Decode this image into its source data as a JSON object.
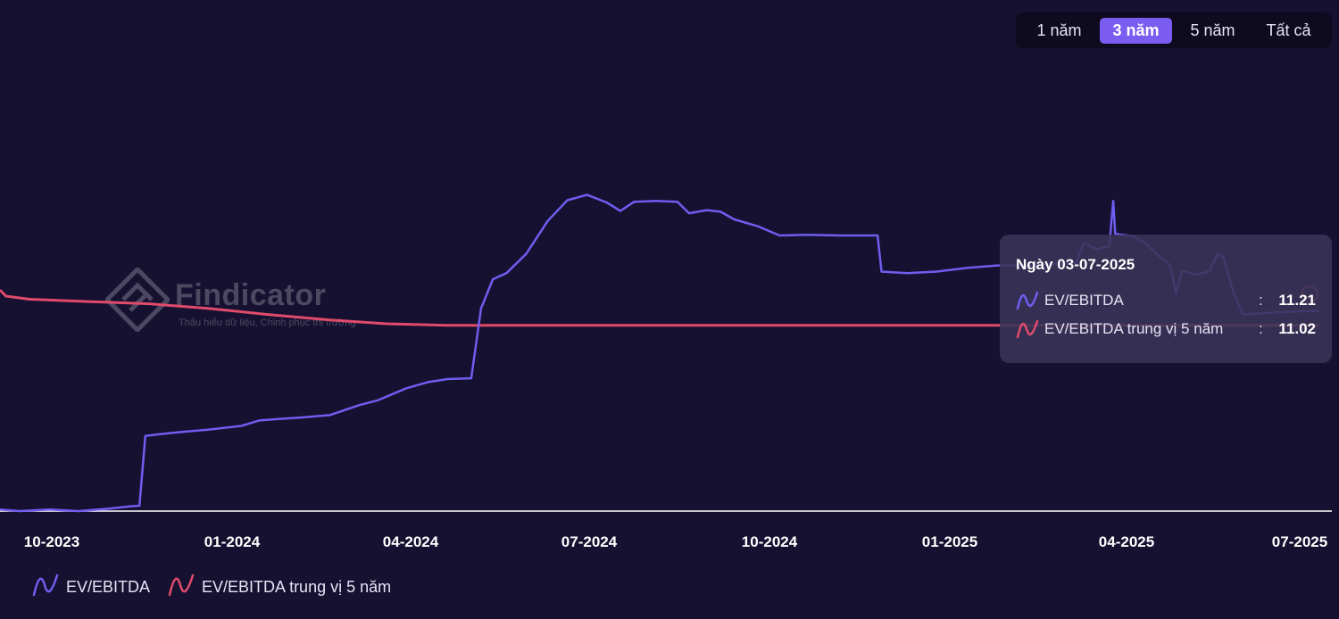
{
  "range_selector": {
    "options": [
      "1 năm",
      "3 năm",
      "5 năm",
      "Tất cả"
    ],
    "selected": "3 năm"
  },
  "watermark": {
    "name": "Findicator",
    "tagline": "Thấu hiểu dữ liệu, Chinh phục thị trường"
  },
  "tooltip": {
    "title": "Ngày 03-07-2025",
    "rows": [
      {
        "label": "EV/EBITDA",
        "colon": ":",
        "value": "11.21"
      },
      {
        "label": "EV/EBITDA trung vị 5 năm",
        "colon": ":",
        "value": "11.02"
      }
    ]
  },
  "legend": [
    {
      "label": "EV/EBITDA",
      "icon": "wave-icon"
    },
    {
      "label": "EV/EBITDA trung vị 5 năm",
      "icon": "wave-icon"
    }
  ],
  "colors": {
    "background": "#161130",
    "ev_ebitda": "#6f5df0",
    "median": "#e14b6b",
    "accent": "#7b5cf0"
  },
  "chart_data": {
    "type": "line",
    "title": "",
    "xlabel": "",
    "ylabel": "",
    "x_ticks": [
      "10-2023",
      "01-2024",
      "04-2024",
      "07-2024",
      "10-2024",
      "01-2025",
      "04-2025",
      "07-2025"
    ],
    "x_range": [
      "2023-08-31",
      "2025-07-03"
    ],
    "y_range": [
      8.6,
      15.2
    ],
    "grid": false,
    "legend_position": "bottom-left",
    "series": [
      {
        "name": "EV/EBITDA",
        "points": [
          [
            "2023-08-31",
            8.62
          ],
          [
            "2023-09-10",
            8.6
          ],
          [
            "2023-09-25",
            8.62
          ],
          [
            "2023-10-10",
            8.6
          ],
          [
            "2023-10-25",
            8.63
          ],
          [
            "2023-11-05",
            8.66
          ],
          [
            "2023-11-10",
            8.67
          ],
          [
            "2023-11-13",
            9.58
          ],
          [
            "2023-11-20",
            9.6
          ],
          [
            "2023-12-01",
            9.63
          ],
          [
            "2023-12-15",
            9.66
          ],
          [
            "2024-01-01",
            9.71
          ],
          [
            "2024-01-10",
            9.78
          ],
          [
            "2024-01-20",
            9.8
          ],
          [
            "2024-02-01",
            9.82
          ],
          [
            "2024-02-15",
            9.85
          ],
          [
            "2024-03-01",
            9.98
          ],
          [
            "2024-03-10",
            10.04
          ],
          [
            "2024-03-25",
            10.2
          ],
          [
            "2024-04-05",
            10.28
          ],
          [
            "2024-04-15",
            10.32
          ],
          [
            "2024-04-27",
            10.33
          ],
          [
            "2024-05-02",
            11.24
          ],
          [
            "2024-05-08",
            11.62
          ],
          [
            "2024-05-15",
            11.7
          ],
          [
            "2024-05-25",
            11.95
          ],
          [
            "2024-06-05",
            12.38
          ],
          [
            "2024-06-15",
            12.65
          ],
          [
            "2024-06-25",
            12.72
          ],
          [
            "2024-07-05",
            12.62
          ],
          [
            "2024-07-12",
            12.51
          ],
          [
            "2024-07-19",
            12.63
          ],
          [
            "2024-07-30",
            12.64
          ],
          [
            "2024-08-10",
            12.63
          ],
          [
            "2024-08-16",
            12.48
          ],
          [
            "2024-08-25",
            12.52
          ],
          [
            "2024-09-01",
            12.5
          ],
          [
            "2024-09-08",
            12.4
          ],
          [
            "2024-09-20",
            12.31
          ],
          [
            "2024-10-01",
            12.19
          ],
          [
            "2024-10-15",
            12.2
          ],
          [
            "2024-11-01",
            12.19
          ],
          [
            "2024-11-20",
            12.19
          ],
          [
            "2024-11-22",
            11.72
          ],
          [
            "2024-12-05",
            11.7
          ],
          [
            "2024-12-20",
            11.72
          ],
          [
            "2025-01-05",
            11.77
          ],
          [
            "2025-01-20",
            11.8
          ],
          [
            "2025-02-05",
            11.8
          ],
          [
            "2025-02-20",
            11.82
          ],
          [
            "2025-03-01",
            11.83
          ],
          [
            "2025-03-05",
            12.09
          ],
          [
            "2025-03-12",
            12.01
          ],
          [
            "2025-03-18",
            12.05
          ],
          [
            "2025-03-20",
            12.64
          ],
          [
            "2025-03-21",
            12.21
          ],
          [
            "2025-03-30",
            12.18
          ],
          [
            "2025-04-05",
            12.1
          ],
          [
            "2025-04-12",
            11.93
          ],
          [
            "2025-04-18",
            11.8
          ],
          [
            "2025-04-21",
            11.44
          ],
          [
            "2025-04-24",
            11.73
          ],
          [
            "2025-05-01",
            11.68
          ],
          [
            "2025-05-08",
            11.72
          ],
          [
            "2025-05-12",
            11.95
          ],
          [
            "2025-05-15",
            11.91
          ],
          [
            "2025-05-20",
            11.47
          ],
          [
            "2025-05-25",
            11.16
          ],
          [
            "2025-06-05",
            11.18
          ],
          [
            "2025-06-20",
            11.2
          ],
          [
            "2025-07-03",
            11.21
          ]
        ]
      },
      {
        "name": "EV/EBITDA trung vị 5 năm",
        "points": [
          [
            "2023-08-31",
            11.48
          ],
          [
            "2023-09-03",
            11.4
          ],
          [
            "2023-09-15",
            11.36
          ],
          [
            "2023-10-15",
            11.33
          ],
          [
            "2023-11-15",
            11.3
          ],
          [
            "2023-12-15",
            11.24
          ],
          [
            "2024-01-15",
            11.16
          ],
          [
            "2024-02-15",
            11.09
          ],
          [
            "2024-03-15",
            11.04
          ],
          [
            "2024-04-15",
            11.02
          ],
          [
            "2024-07-01",
            11.02
          ],
          [
            "2025-01-01",
            11.02
          ],
          [
            "2025-07-03",
            11.02
          ]
        ]
      }
    ]
  }
}
